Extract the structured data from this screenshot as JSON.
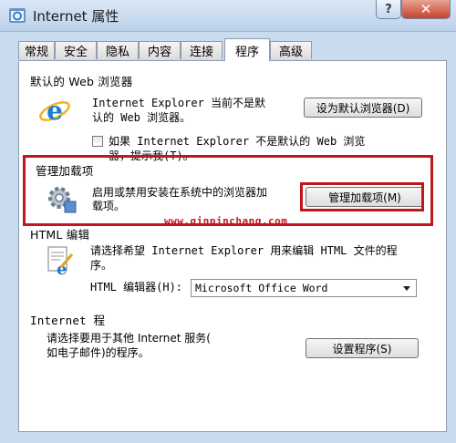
{
  "window": {
    "title": "Internet 属性",
    "help_label": "?",
    "close_label": "✕"
  },
  "tabs": [
    {
      "label": "常规"
    },
    {
      "label": "安全"
    },
    {
      "label": "隐私"
    },
    {
      "label": "内容"
    },
    {
      "label": "连接"
    },
    {
      "label": "程序",
      "active": true
    },
    {
      "label": "高级"
    }
  ],
  "default_browser": {
    "title": "默认的 Web 浏览器",
    "line1": "Internet Explorer 当前不是默",
    "line2": "认的 Web 浏览器。",
    "button": "设为默认浏览器(D)",
    "check_line1": "如果 Internet Explorer 不是默认的 Web 浏览",
    "check_line2": "器，提示我(T)。",
    "checked": false
  },
  "addons": {
    "title": "管理加载项",
    "line1": "启用或禁用安装在系统中的浏览器加",
    "line2": "载项。",
    "button": "管理加载项(M)"
  },
  "watermark": "www.qinpinchang.com",
  "html_editing": {
    "title": "HTML 编辑",
    "line1": "请选择希望 Internet Explorer 用来编辑 HTML 文件的程",
    "line2": "序。",
    "editor_label": "HTML 编辑器(H):",
    "editor_value": "Microsoft Office Word"
  },
  "programs": {
    "title": "Internet 程",
    "line1": "请选择要用于其他 Internet 服务(",
    "line2": "如电子邮件)的程序。",
    "button": "设置程序(S)"
  },
  "colors": {
    "highlight": "#c0161d",
    "titlebar": "#c9dbee"
  }
}
